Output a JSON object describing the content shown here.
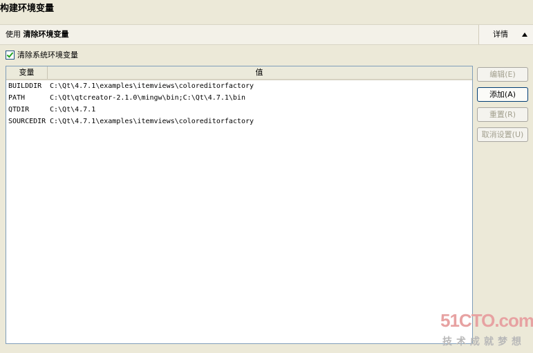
{
  "page": {
    "title": "构建环境变量"
  },
  "summary": {
    "prefix": "使用",
    "value": "清除环境变量",
    "details_label": "详情"
  },
  "options": {
    "clear_system_env_label": "清除系统环境变量",
    "clear_system_env_checked": true
  },
  "table": {
    "columns": [
      "变量",
      "值"
    ],
    "rows": [
      {
        "name": "BUILDDIR",
        "value": "C:\\Qt\\4.7.1\\examples\\itemviews\\coloreditorfactory"
      },
      {
        "name": "PATH",
        "value": "C:\\Qt\\qtcreator-2.1.0\\mingw\\bin;C:\\Qt\\4.7.1\\bin"
      },
      {
        "name": "QTDIR",
        "value": "C:\\Qt\\4.7.1"
      },
      {
        "name": "SOURCEDIR",
        "value": "C:\\Qt\\4.7.1\\examples\\itemviews\\coloreditorfactory"
      }
    ]
  },
  "buttons": {
    "edit": {
      "label": "编辑(E)",
      "enabled": false
    },
    "add": {
      "label": "添加(A)",
      "enabled": true
    },
    "reset": {
      "label": "重置(R)",
      "enabled": false
    },
    "unset": {
      "label": "取消设置(U)",
      "enabled": false
    }
  },
  "watermark": {
    "logo": "51CTO.com",
    "tagline": "技术成就梦想"
  }
}
